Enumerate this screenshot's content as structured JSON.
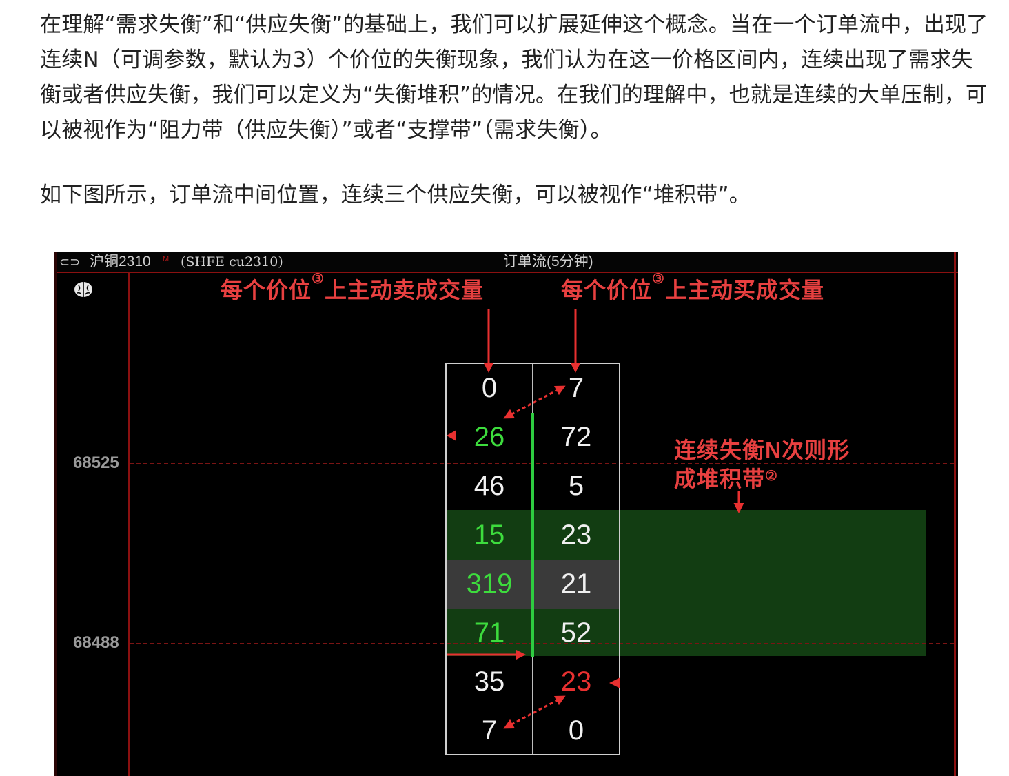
{
  "article": {
    "paragraph1": "在理解“需求失衡”和“供应失衡”的基础上，我们可以扩展延伸这个概念。当在一个订单流中，出现了连续N（可调参数，默认为3）个价位的失衡现象，我们认为在这一价格区间内，连续出现了需求失衡或者供应失衡，我们可以定义为“失衡堆积”的情况。在我们的理解中，也就是连续的大单压制，可以被视作为“阻力带（供应失衡）”或者“支撑带”（需求失衡）。",
    "paragraph2": "如下图所示，订单流中间位置，连续三个供应失衡，可以被视作“堆积带”。"
  },
  "figure": {
    "titlebar": {
      "link_icon": "⊂⊃",
      "instrument": "沪铜2310",
      "instrument_sup": "M",
      "code": "(SHFE  cu2310)",
      "window_title": "订单流(5分钟)"
    },
    "brain_icon": "brain-icon",
    "price_axis": [
      "68525",
      "68488"
    ],
    "annotations": {
      "sell_label": "每个价位",
      "sell_label_mark": "③",
      "sell_label_tail": "上主动卖成交量",
      "buy_label": "每个价位",
      "buy_label_mark": "③",
      "buy_label_tail": "上主动买成交量",
      "band_label_line1": "连续失衡N次则形",
      "band_label_line2": "成堆积带",
      "band_label_mark": "②"
    },
    "footprint": {
      "rows": [
        {
          "sell": "0",
          "buy": "7",
          "sell_color": "#f0f0f0",
          "buy_color": "#f0f0f0"
        },
        {
          "sell": "26",
          "buy": "72",
          "sell_color": "#3ddc3d",
          "buy_color": "#f0f0f0"
        },
        {
          "sell": "46",
          "buy": "5",
          "sell_color": "#f0f0f0",
          "buy_color": "#f0f0f0"
        },
        {
          "sell": "15",
          "buy": "23",
          "sell_color": "#3ddc3d",
          "buy_color": "#f0f0f0"
        },
        {
          "sell": "319",
          "buy": "21",
          "sell_color": "#3ddc3d",
          "buy_color": "#f0f0f0"
        },
        {
          "sell": "71",
          "buy": "52",
          "sell_color": "#3ddc3d",
          "buy_color": "#f0f0f0"
        },
        {
          "sell": "35",
          "buy": "23",
          "sell_color": "#f0f0f0",
          "buy_color": "#e83030"
        },
        {
          "sell": "7",
          "buy": "0",
          "sell_color": "#f0f0f0",
          "buy_color": "#f0f0f0"
        }
      ]
    },
    "colors": {
      "background": "#000000",
      "annotation_red": "#e84040",
      "imbalance_green": "#3ddc3d",
      "stack_band": "#123d12"
    }
  }
}
